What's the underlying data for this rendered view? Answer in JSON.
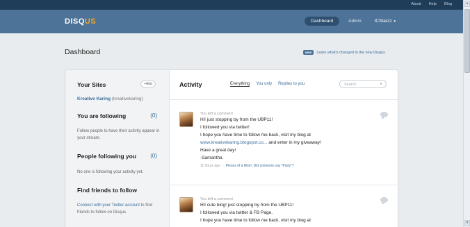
{
  "toplinks": [
    "About",
    "Help",
    "Blog"
  ],
  "logo": {
    "part1": "DISQ",
    "part2": "US"
  },
  "nav": {
    "dashboard": "Dashboard",
    "admin": "Admin",
    "user": "ICStarzz"
  },
  "page": {
    "title": "Dashboard",
    "news_badge": "NEW",
    "news_link": "Learn what's changed in the new Disqus"
  },
  "sidebar": {
    "your_sites": "Your Sites",
    "add": "+Add",
    "site_name": "Kreative Karing",
    "site_short": "(kreativekaring)",
    "you_following": "You are following",
    "you_following_count": "(0)",
    "you_following_text": "Follow people to have their activity appear in your stream.",
    "followers": "People following you",
    "followers_count": "(0)",
    "followers_text": "No one is following your activity yet.",
    "find_friends": "Find friends to follow",
    "connect_link": "Connect with your Twitter account",
    "connect_rest": " to find friends to follow on Disqus."
  },
  "activity": {
    "title": "Activity",
    "tabs": [
      "Everything",
      "You only",
      "Replies to you"
    ],
    "search_placeholder": "Search"
  },
  "posts": [
    {
      "label": "You left a comment",
      "lines": [
        "Hi! just stopping by from the UBP11!",
        "I followed you via twitter!",
        "I hope you have time to follow me back, visit my blog at"
      ],
      "link": "www.kreativekaring.blogspot.co...",
      "link_rest": " and enter in my giveaway!",
      "tail": [
        "Have a great day!",
        "-Samantha"
      ],
      "time": "11 hours ago",
      "ref": "Pieces of a Mom: Did someone say \"Party\"?"
    },
    {
      "label": "You left a comment",
      "lines": [
        "Hi! cute blog! just stopping by from the UBP11!",
        "I followed you via twitter & FB Page.",
        "I hope you have time to follow me back, visit my blog at"
      ]
    }
  ],
  "colors": {
    "topbar": "#1f3c58",
    "header": "#4e7398",
    "accent": "#3a6d9a",
    "logo_accent": "#f5a623"
  }
}
